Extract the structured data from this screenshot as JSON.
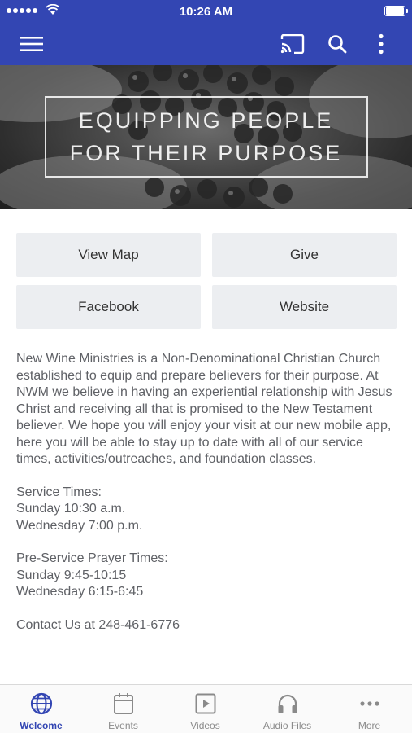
{
  "status_bar": {
    "time": "10:26 AM"
  },
  "app_bar": {
    "icons": [
      "menu-icon",
      "cast-icon",
      "search-icon",
      "more-vertical-icon"
    ],
    "color": "#3346b3"
  },
  "hero": {
    "line1": "EQUIPPING PEOPLE",
    "line2": "FOR THEIR PURPOSE"
  },
  "buttons": {
    "view_map": "View Map",
    "give": "Give",
    "facebook": "Facebook",
    "website": "Website"
  },
  "description": {
    "intro": "New Wine Ministries is a Non-Denominational Christian Church established to equip and prepare believers for their purpose. At NWM we believe in having an experiential relationship with Jesus Christ and receiving all that is promised to the New Testament believer.  We hope you will enjoy your visit at our new mobile app, here you will be able to stay up to date with all of our service times, activities/outreaches, and foundation classes.",
    "service_heading": "Service Times:",
    "service_sunday": "Sunday 10:30 a.m.",
    "service_wednesday": "Wednesday 7:00 p.m.",
    "prayer_heading": "Pre-Service Prayer Times:",
    "prayer_sunday": "Sunday 9:45-10:15",
    "prayer_wednesday": "Wednesday 6:15-6:45",
    "contact": "Contact Us at 248-461-6776"
  },
  "tabs": [
    {
      "label": "Welcome",
      "icon": "globe-icon",
      "active": true
    },
    {
      "label": "Events",
      "icon": "calendar-icon",
      "active": false
    },
    {
      "label": "Videos",
      "icon": "video-icon",
      "active": false
    },
    {
      "label": "Audio Files",
      "icon": "headphones-icon",
      "active": false
    },
    {
      "label": "More",
      "icon": "more-horizontal-icon",
      "active": false
    }
  ],
  "colors": {
    "accent": "#3346b3",
    "tile": "#eceef1",
    "text": "#5f6166",
    "inactive_tab": "#8a8a8a"
  }
}
